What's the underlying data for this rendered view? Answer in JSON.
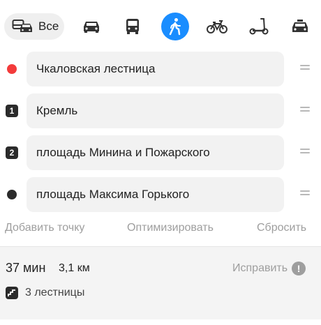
{
  "transport": {
    "modes": [
      {
        "id": "all",
        "label": "Все",
        "icon": "all-transport-icon",
        "selected": false
      },
      {
        "id": "car",
        "icon": "car-icon"
      },
      {
        "id": "transit",
        "icon": "bus-icon"
      },
      {
        "id": "pedestrian",
        "icon": "walking-icon",
        "selected": true
      },
      {
        "id": "bicycle",
        "icon": "bicycle-icon"
      },
      {
        "id": "scooter",
        "icon": "scooter-icon"
      },
      {
        "id": "taxi",
        "icon": "taxi-icon"
      }
    ]
  },
  "route": {
    "waypoints": [
      {
        "marker": "start",
        "value": "Чкаловская лестница"
      },
      {
        "marker": "1",
        "value": "Кремль"
      },
      {
        "marker": "2",
        "value": "площадь Минина и Пожарского"
      },
      {
        "marker": "finish",
        "value": "площадь Максима Горького"
      }
    ],
    "add_point": "Добавить точку",
    "optimize": "Оптимизировать",
    "reset": "Сбросить"
  },
  "summary": {
    "time": "37 мин",
    "distance": "3,1 км",
    "fix_label": "Исправить",
    "fix_icon": "!",
    "stairs": "3 лестницы"
  },
  "colors": {
    "accent": "#1a8dff",
    "start_marker": "#f33b3b",
    "dark_marker": "#2b2b2b"
  }
}
